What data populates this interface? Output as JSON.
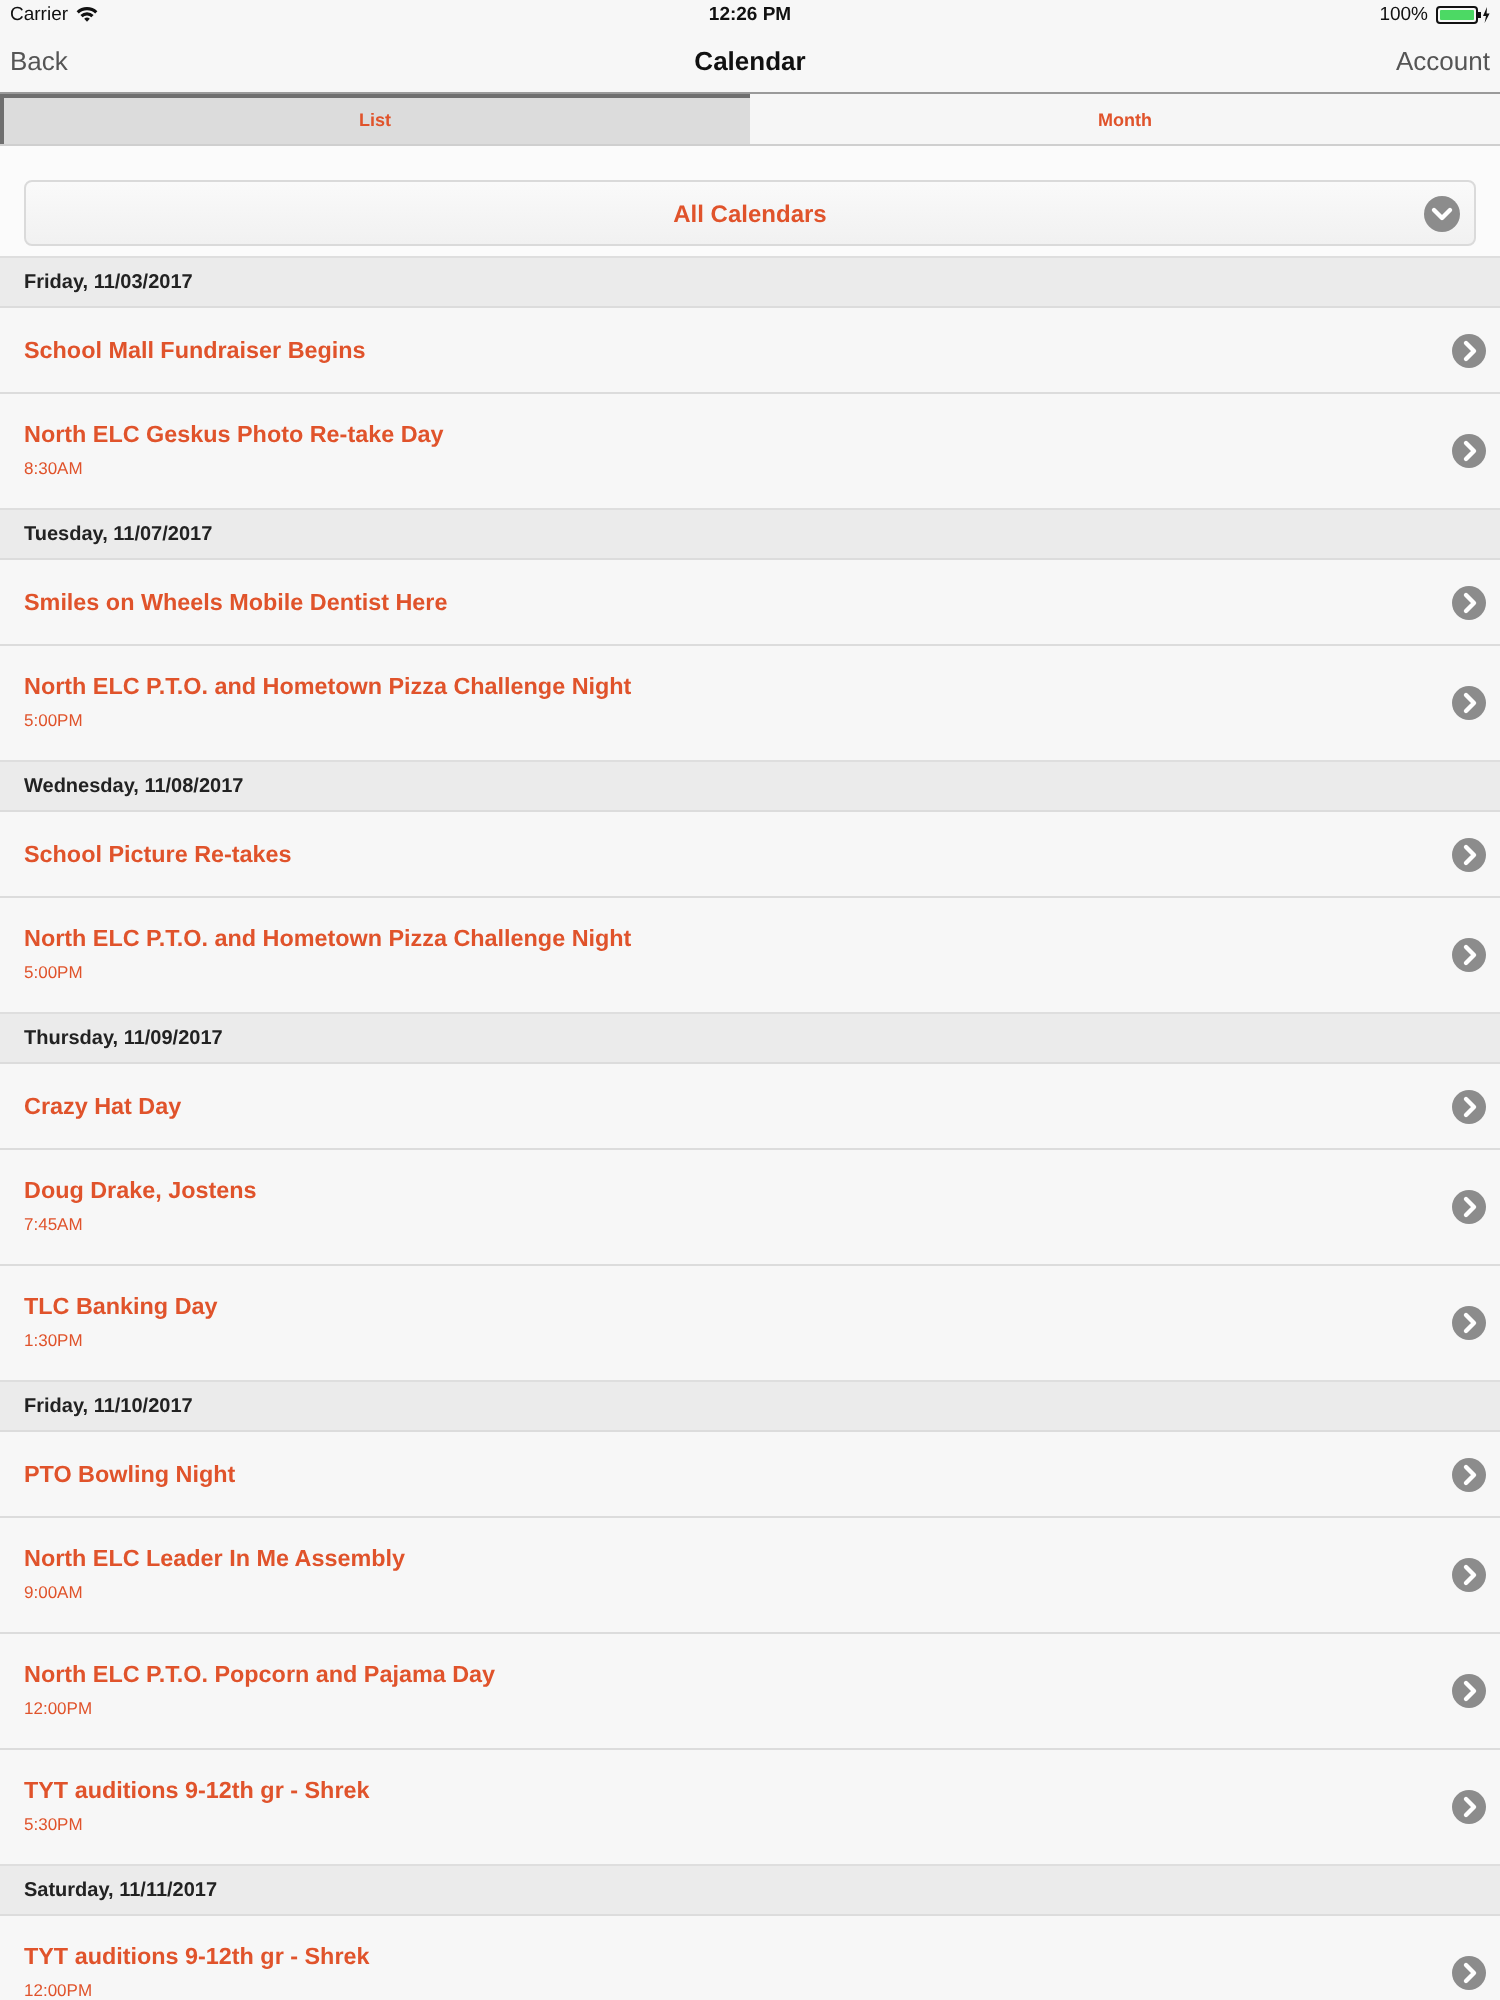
{
  "status_bar": {
    "carrier": "Carrier",
    "time": "12:26 PM",
    "battery": "100%"
  },
  "nav_bar": {
    "back": "Back",
    "title": "Calendar",
    "account": "Account"
  },
  "tabs": [
    {
      "label": "List",
      "selected": true
    },
    {
      "label": "Month",
      "selected": false
    }
  ],
  "calendar_filter": {
    "value": "All Calendars"
  },
  "sections": [
    {
      "date": "Friday, 11/03/2017",
      "events": [
        {
          "title": "School Mall Fundraiser Begins"
        },
        {
          "title": "North ELC Geskus Photo Re-take Day",
          "time": "8:30AM"
        }
      ]
    },
    {
      "date": "Tuesday, 11/07/2017",
      "events": [
        {
          "title": "Smiles on Wheels Mobile Dentist Here"
        },
        {
          "title": "North ELC P.T.O. and Hometown Pizza Challenge Night",
          "time": "5:00PM"
        }
      ]
    },
    {
      "date": "Wednesday, 11/08/2017",
      "events": [
        {
          "title": "School Picture Re-takes"
        },
        {
          "title": "North ELC P.T.O. and Hometown Pizza Challenge Night",
          "time": "5:00PM"
        }
      ]
    },
    {
      "date": "Thursday, 11/09/2017",
      "events": [
        {
          "title": "Crazy Hat Day"
        },
        {
          "title": "Doug Drake, Jostens",
          "time": "7:45AM"
        },
        {
          "title": "TLC Banking Day",
          "time": "1:30PM"
        }
      ]
    },
    {
      "date": "Friday, 11/10/2017",
      "events": [
        {
          "title": "PTO Bowling Night"
        },
        {
          "title": "North ELC Leader In Me Assembly",
          "time": "9:00AM"
        },
        {
          "title": "North ELC P.T.O. Popcorn and Pajama Day",
          "time": "12:00PM"
        },
        {
          "title": "TYT auditions 9-12th gr - Shrek",
          "time": "5:30PM"
        }
      ]
    },
    {
      "date": "Saturday, 11/11/2017",
      "events": [
        {
          "title": "TYT auditions 9-12th gr - Shrek",
          "time": "12:00PM"
        }
      ]
    }
  ]
}
